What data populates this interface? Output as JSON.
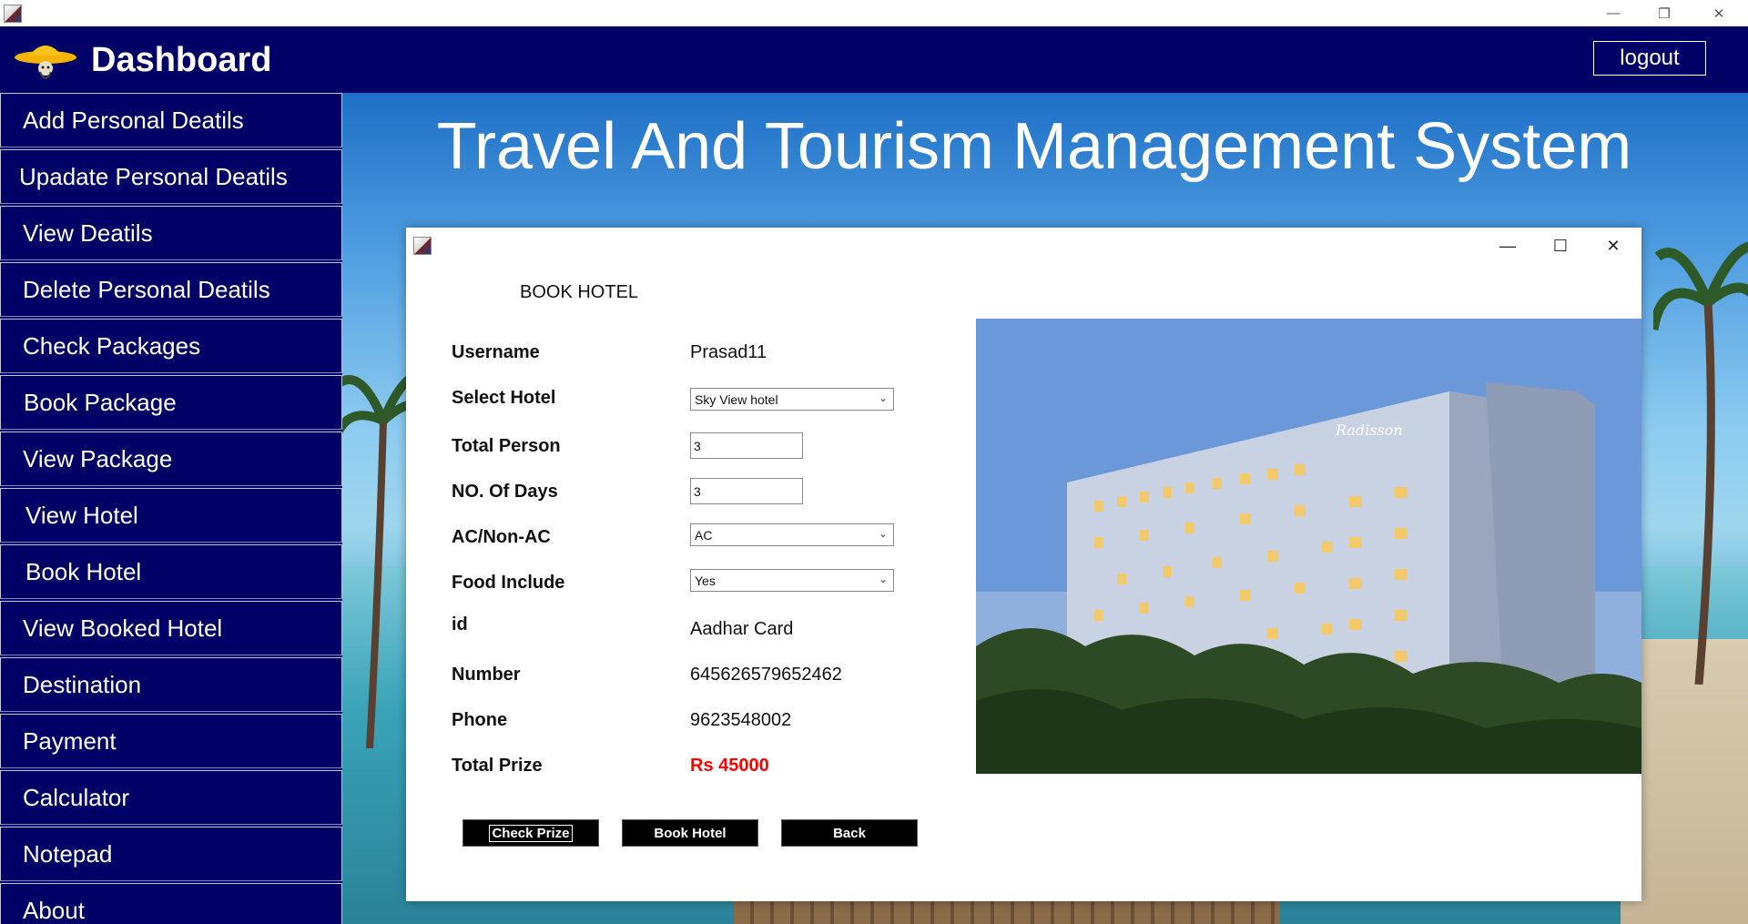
{
  "window": {
    "minimize_glyph": "—",
    "restore_glyph": "❐",
    "close_glyph": "✕"
  },
  "header": {
    "title": "Dashboard",
    "logout_label": "logout",
    "logo_icon": "hat-logo-icon"
  },
  "sidebar": {
    "items": [
      {
        "label": "Add Personal Deatils"
      },
      {
        "label": "Upadate Personal Deatils"
      },
      {
        "label": "View Deatils"
      },
      {
        "label": "Delete Personal Deatils"
      },
      {
        "label": "Check Packages"
      },
      {
        "label": "Book Package"
      },
      {
        "label": "View Package"
      },
      {
        "label": "View Hotel"
      },
      {
        "label": "Book Hotel"
      },
      {
        "label": "View Booked Hotel"
      },
      {
        "label": "Destination"
      },
      {
        "label": "Payment"
      },
      {
        "label": "Calculator"
      },
      {
        "label": "Notepad"
      },
      {
        "label": "About"
      }
    ]
  },
  "main": {
    "heading": "Travel And Tourism Management System"
  },
  "dialog": {
    "title": "BOOK HOTEL",
    "minimize_glyph": "—",
    "maximize_glyph": "☐",
    "close_glyph": "✕",
    "labels": {
      "username": "Username",
      "select_hotel": "Select Hotel",
      "total_person": "Total Person",
      "days": "NO. Of Days",
      "ac": "AC/Non-AC",
      "food": "Food Include",
      "id": "id",
      "number": "Number",
      "phone": "Phone",
      "total_prize": "Total Prize"
    },
    "values": {
      "username": "Prasad11",
      "select_hotel": "Sky View hotel",
      "total_person": "3",
      "days": "3",
      "ac": "AC",
      "food": "Yes",
      "id": "Aadhar Card",
      "number": "645626579652462",
      "phone": "9623548002",
      "total_prize": "Rs 45000"
    },
    "image_sign_text": "Radisson",
    "buttons": {
      "check_prize": "Check Prize",
      "book_hotel": "Book Hotel",
      "back": "Back"
    },
    "accent_color": "#ff0000"
  },
  "colors": {
    "header_bg": "#000066",
    "sidebar_bg": "#000066",
    "button_bg": "#000000"
  }
}
